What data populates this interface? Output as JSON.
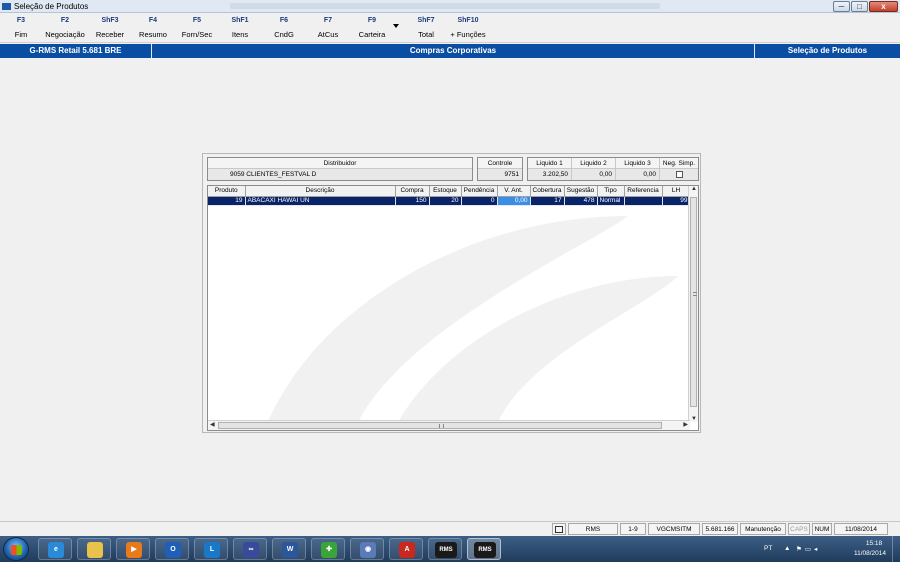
{
  "window": {
    "title": "Seleção de Produtos",
    "min_label": "─",
    "max_label": "□",
    "close_label": "x"
  },
  "toolbar": {
    "keys": [
      {
        "key": "F3",
        "label": "Fim"
      },
      {
        "key": "F2",
        "label": "Negociação"
      },
      {
        "key": "ShF3",
        "label": "Receber"
      },
      {
        "key": "F4",
        "label": "Resumo"
      },
      {
        "key": "F5",
        "label": "Forn/Sec"
      },
      {
        "key": "ShF1",
        "label": "Itens"
      },
      {
        "key": "F6",
        "label": "CndG"
      },
      {
        "key": "F7",
        "label": "AtCus"
      },
      {
        "key": "F9",
        "label": "Carteira"
      },
      {
        "key": "ShF7",
        "label": "Total"
      },
      {
        "key": "ShF10",
        "label": "+ Funções"
      }
    ]
  },
  "band": {
    "left": "G-RMS Retail 5.681 BRE",
    "center": "Compras Corporativas",
    "right": "Seleção de Produtos"
  },
  "header": {
    "distribuidor_label": "Distribuidor",
    "distribuidor_value": "9059  CLIENTES_FESTVAL D",
    "controle_label": "Controle",
    "controle_value": "9751",
    "liquido1_label": "Liquido 1",
    "liquido1_value": "3.202,50",
    "liquido2_label": "Liquido 2",
    "liquido2_value": "0,00",
    "liquido3_label": "Liquido 3",
    "liquido3_value": "0,00",
    "negsimp_label": "Neg. Simp."
  },
  "grid": {
    "columns": [
      "Produto",
      "Descrição",
      "Compra",
      "Estoque",
      "Pendência",
      "V. Ant.",
      "Cobertura",
      "Sugestão",
      "Tipo",
      "Referencia",
      "LH"
    ],
    "rows": [
      {
        "produto": "19",
        "descricao": "ABACAXI HAWAI UN",
        "compra": "150",
        "estoque": "20",
        "pendencia": "0",
        "vant": "0,00",
        "cobertura": "17",
        "sugestao": "478",
        "tipo": "Normal",
        "referencia": "",
        "lh": "99"
      }
    ],
    "scroll": {
      "up": "▲",
      "down": "▼",
      "left": "◀",
      "right": "▶"
    }
  },
  "statusbar": {
    "cells": [
      "RMS",
      "1-9",
      "VGCMSITM",
      "5.681.166",
      "Manutenção",
      "CAPS",
      "NUM",
      "11/08/2014"
    ]
  },
  "taskbar": {
    "apps": [
      {
        "name": "internet-explorer",
        "glyph": "e",
        "color": "#2a8ad8"
      },
      {
        "name": "file-explorer",
        "glyph": "",
        "color": "#e8c24a"
      },
      {
        "name": "media-player",
        "glyph": "▶",
        "color": "#e87a1a"
      },
      {
        "name": "outlook",
        "glyph": "O",
        "color": "#1f5fb8"
      },
      {
        "name": "lync",
        "glyph": "L",
        "color": "#1a78c8"
      },
      {
        "name": "connector",
        "glyph": "∞",
        "color": "#3a4a9a"
      },
      {
        "name": "word",
        "glyph": "W",
        "color": "#2b579a"
      },
      {
        "name": "update-tool",
        "glyph": "✚",
        "color": "#3aa33a"
      },
      {
        "name": "remote-app",
        "glyph": "◉",
        "color": "#5a7ab8"
      },
      {
        "name": "pdf-reader",
        "glyph": "A",
        "color": "#c8281e"
      },
      {
        "name": "rms-1",
        "glyph": "RMS",
        "color": "#1a1a1a"
      },
      {
        "name": "rms-2",
        "glyph": "RMS",
        "color": "#1a1a1a"
      }
    ],
    "tray": {
      "lang": "PT",
      "time": "15:18",
      "date": "11/08/2014"
    }
  },
  "colors": {
    "band": "#0a4ea3",
    "selection": "#0a246a",
    "highlight": "#3b8ee8"
  }
}
